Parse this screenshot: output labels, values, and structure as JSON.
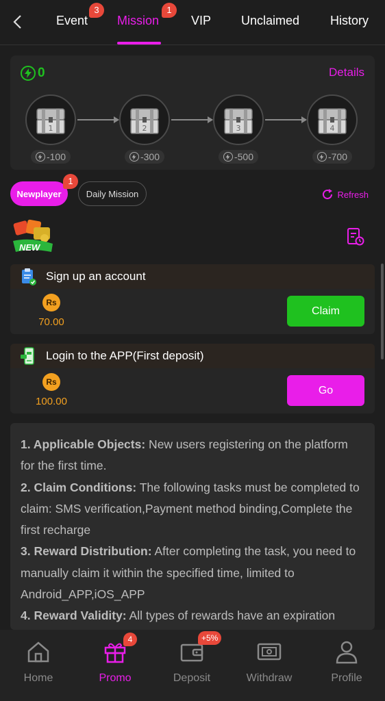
{
  "nav": {
    "tabs": [
      {
        "label": "Event",
        "badge": "3"
      },
      {
        "label": "Mission",
        "badge": "1"
      },
      {
        "label": "VIP"
      },
      {
        "label": "Unclaimed"
      },
      {
        "label": "History"
      }
    ],
    "active_tab": "Mission"
  },
  "treasure": {
    "energy": "0",
    "details_label": "Details",
    "chests": [
      {
        "number": "1",
        "cost": "-100"
      },
      {
        "number": "2",
        "cost": "-300"
      },
      {
        "number": "3",
        "cost": "-500"
      },
      {
        "number": "4",
        "cost": "-700"
      }
    ]
  },
  "subtabs": {
    "newplayer_label": "Newplayer",
    "newplayer_badge": "1",
    "daily_label": "Daily Mission",
    "refresh_label": "Refresh"
  },
  "new_badge": "NEW",
  "tasks": [
    {
      "title": "Sign up an account",
      "currency": "Rs",
      "reward": "70.00",
      "button": "Claim"
    },
    {
      "title": "Login to the APP(First deposit)",
      "currency": "Rs",
      "reward": "100.00",
      "button": "Go"
    }
  ],
  "rules": [
    {
      "heading": "1. Applicable Objects:",
      "text": " New users registering on the platform for the first time."
    },
    {
      "heading": "2. Claim Conditions:",
      "text": " The following tasks must be completed to claim: SMS verification,Payment method binding,Complete the first recharge"
    },
    {
      "heading": "3. Reward Distribution:",
      "text": " After completing the task, you need to manually claim it within the specified time, limited to Android_APP,iOS_APP"
    },
    {
      "heading": "4. Reward Validity:",
      "text": " All types of rewards have an expiration"
    }
  ],
  "bottom_nav": [
    {
      "label": "Home",
      "icon": "home-icon"
    },
    {
      "label": "Promo",
      "icon": "gift-icon",
      "badge": "4"
    },
    {
      "label": "Deposit",
      "icon": "wallet-icon",
      "badge": "+5%"
    },
    {
      "label": "Withdraw",
      "icon": "withdraw-icon"
    },
    {
      "label": "Profile",
      "icon": "profile-icon"
    }
  ],
  "colors": {
    "accent": "#e91ee9",
    "green": "#1fc11f",
    "gold": "#f2a020",
    "badge": "#e8483a"
  }
}
